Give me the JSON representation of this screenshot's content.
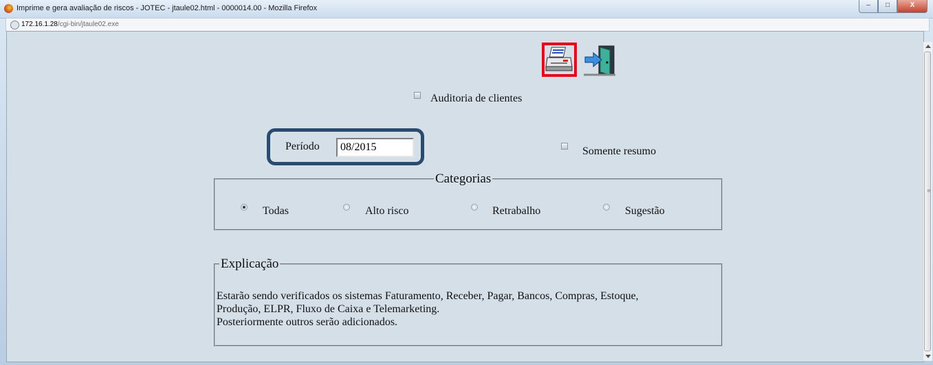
{
  "window": {
    "title": "Imprime e gera avaliação de riscos - JOTEC - jtaule02.html - 0000014.00 - Mozilla Firefox",
    "url_host": "172.16.1.28",
    "url_path": "/cgi-bin/jtaule02.exe",
    "minimize": "–",
    "maximize": "□",
    "close": "X"
  },
  "toolbar": {
    "print_icon": "printer-icon",
    "exit_icon": "exit-door-icon"
  },
  "form": {
    "auditoria_label": "Auditoria de clientes",
    "auditoria_checked": false,
    "periodo_label": "Período",
    "periodo_value": "08/2015",
    "somente_resumo_label": "Somente resumo",
    "somente_resumo_checked": false
  },
  "categorias": {
    "legend": "Categorias",
    "options": [
      {
        "label": "Todas",
        "selected": true
      },
      {
        "label": "Alto risco",
        "selected": false
      },
      {
        "label": "Retrabalho",
        "selected": false
      },
      {
        "label": "Sugestão",
        "selected": false
      }
    ]
  },
  "explicacao": {
    "legend": "Explicação",
    "line1": "Estarão sendo verificados os sistemas Faturamento, Receber, Pagar, Bancos, Compras, Estoque,",
    "line2": "Produção, ELPR, Fluxo de Caixa e Telemarketing.",
    "line3": "Posteriormente outros serão adicionados."
  },
  "colors": {
    "highlight_red": "#e5061b",
    "highlight_blue": "#2a4a70",
    "page_bg": "#d5dfe8"
  }
}
